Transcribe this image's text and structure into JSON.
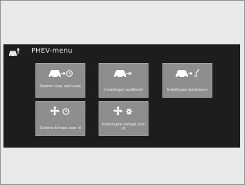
{
  "header": {
    "icon": "car-plug-icon",
    "title": "PHEV-menu"
  },
  "tiles": [
    {
      "label": "Plannen voor niet laden",
      "icon": "car-charge-clock-icon"
    },
    {
      "label": "Instellingen laadlimiet",
      "icon": "car-charge-icon"
    },
    {
      "label": "Instellingen laadstroom",
      "icon": "car-charge-current-icon"
    },
    {
      "label": "Schema klimaat voor rit",
      "icon": "fan-clock-icon"
    },
    {
      "label": "Instellingen klimaat voor rit",
      "icon": "fan-gear-icon"
    }
  ],
  "colors": {
    "screen": "#1d1d1d",
    "tile": "#8e8e8e",
    "page": "#e9e9e9"
  }
}
